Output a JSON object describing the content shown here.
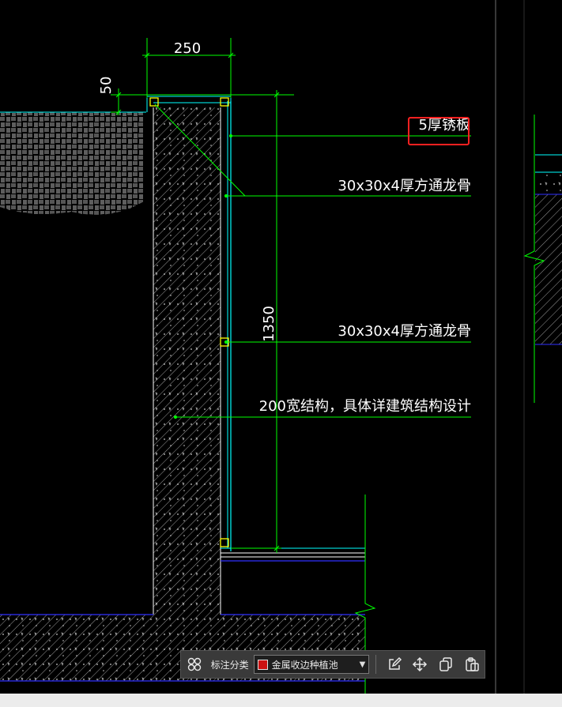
{
  "drawing": {
    "dim_top_width": "250",
    "dim_step": "50",
    "dim_height": "1350",
    "leaders": [
      {
        "name": "leader-rust-plate",
        "text": "5厚锈板"
      },
      {
        "name": "leader-steel-keel-top",
        "text": "30x30x4厚方通龙骨"
      },
      {
        "name": "leader-steel-keel-mid",
        "text": "30x30x4厚方通龙骨"
      },
      {
        "name": "leader-structure",
        "text": "200宽结构，具体详建筑结构设计"
      }
    ],
    "colors": {
      "background": "#000000",
      "dimension": "#00ff00",
      "leader": "#00ff00",
      "text": "#ffffff",
      "outline": "#ffffff",
      "cladding": "#00ffff",
      "base_line": "#0000ff",
      "node_marker": "#ffff00",
      "highlight": "#ff0000"
    }
  },
  "toolbar": {
    "grid_icon": "grid-icon",
    "category_label": "标注分类",
    "category_value": "金属收边种植池",
    "category_color": "#cc1111",
    "buttons": [
      {
        "name": "edit-annotation-button",
        "icon": "pencil-square-icon"
      },
      {
        "name": "move-annotation-button",
        "icon": "move-arrows-icon"
      },
      {
        "name": "copy-annotation-button",
        "icon": "copy-icon"
      },
      {
        "name": "paste-annotation-button",
        "icon": "paste-icon"
      }
    ]
  }
}
